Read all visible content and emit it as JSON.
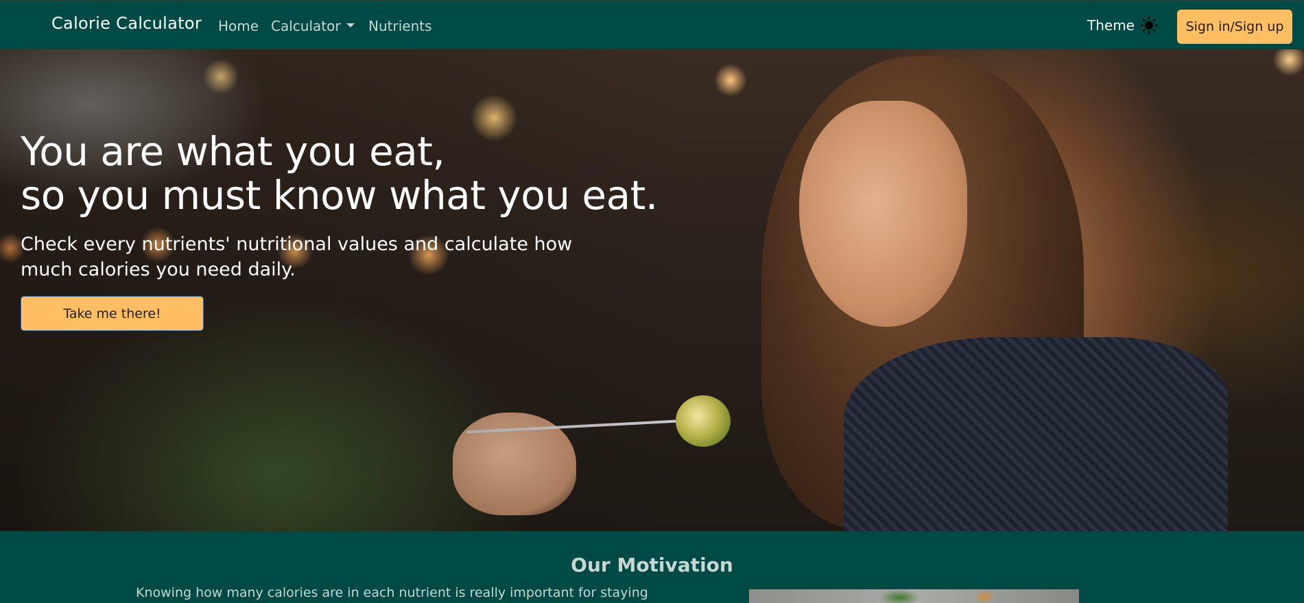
{
  "navbar": {
    "brand": "Calorie Calculator",
    "links": [
      {
        "label": "Home"
      },
      {
        "label": "Calculator"
      },
      {
        "label": "Nutrients"
      }
    ],
    "theme_label": "Theme",
    "theme_icon": "sun-icon",
    "signin_label": "Sign in/Sign up"
  },
  "hero": {
    "title_line1": "You are what you eat,",
    "title_line2": "so you must know what you eat.",
    "subtitle": "Check every nutrients' nutritional values and calculate how much calories you need daily.",
    "cta_label": "Take me there!"
  },
  "motivation": {
    "title": "Our Motivation",
    "text": "Knowing how many calories are in each nutrient is really important for staying"
  },
  "colors": {
    "primary": "#004a45",
    "accent": "#ffbe62",
    "nav_text": "#c9d6d4"
  }
}
